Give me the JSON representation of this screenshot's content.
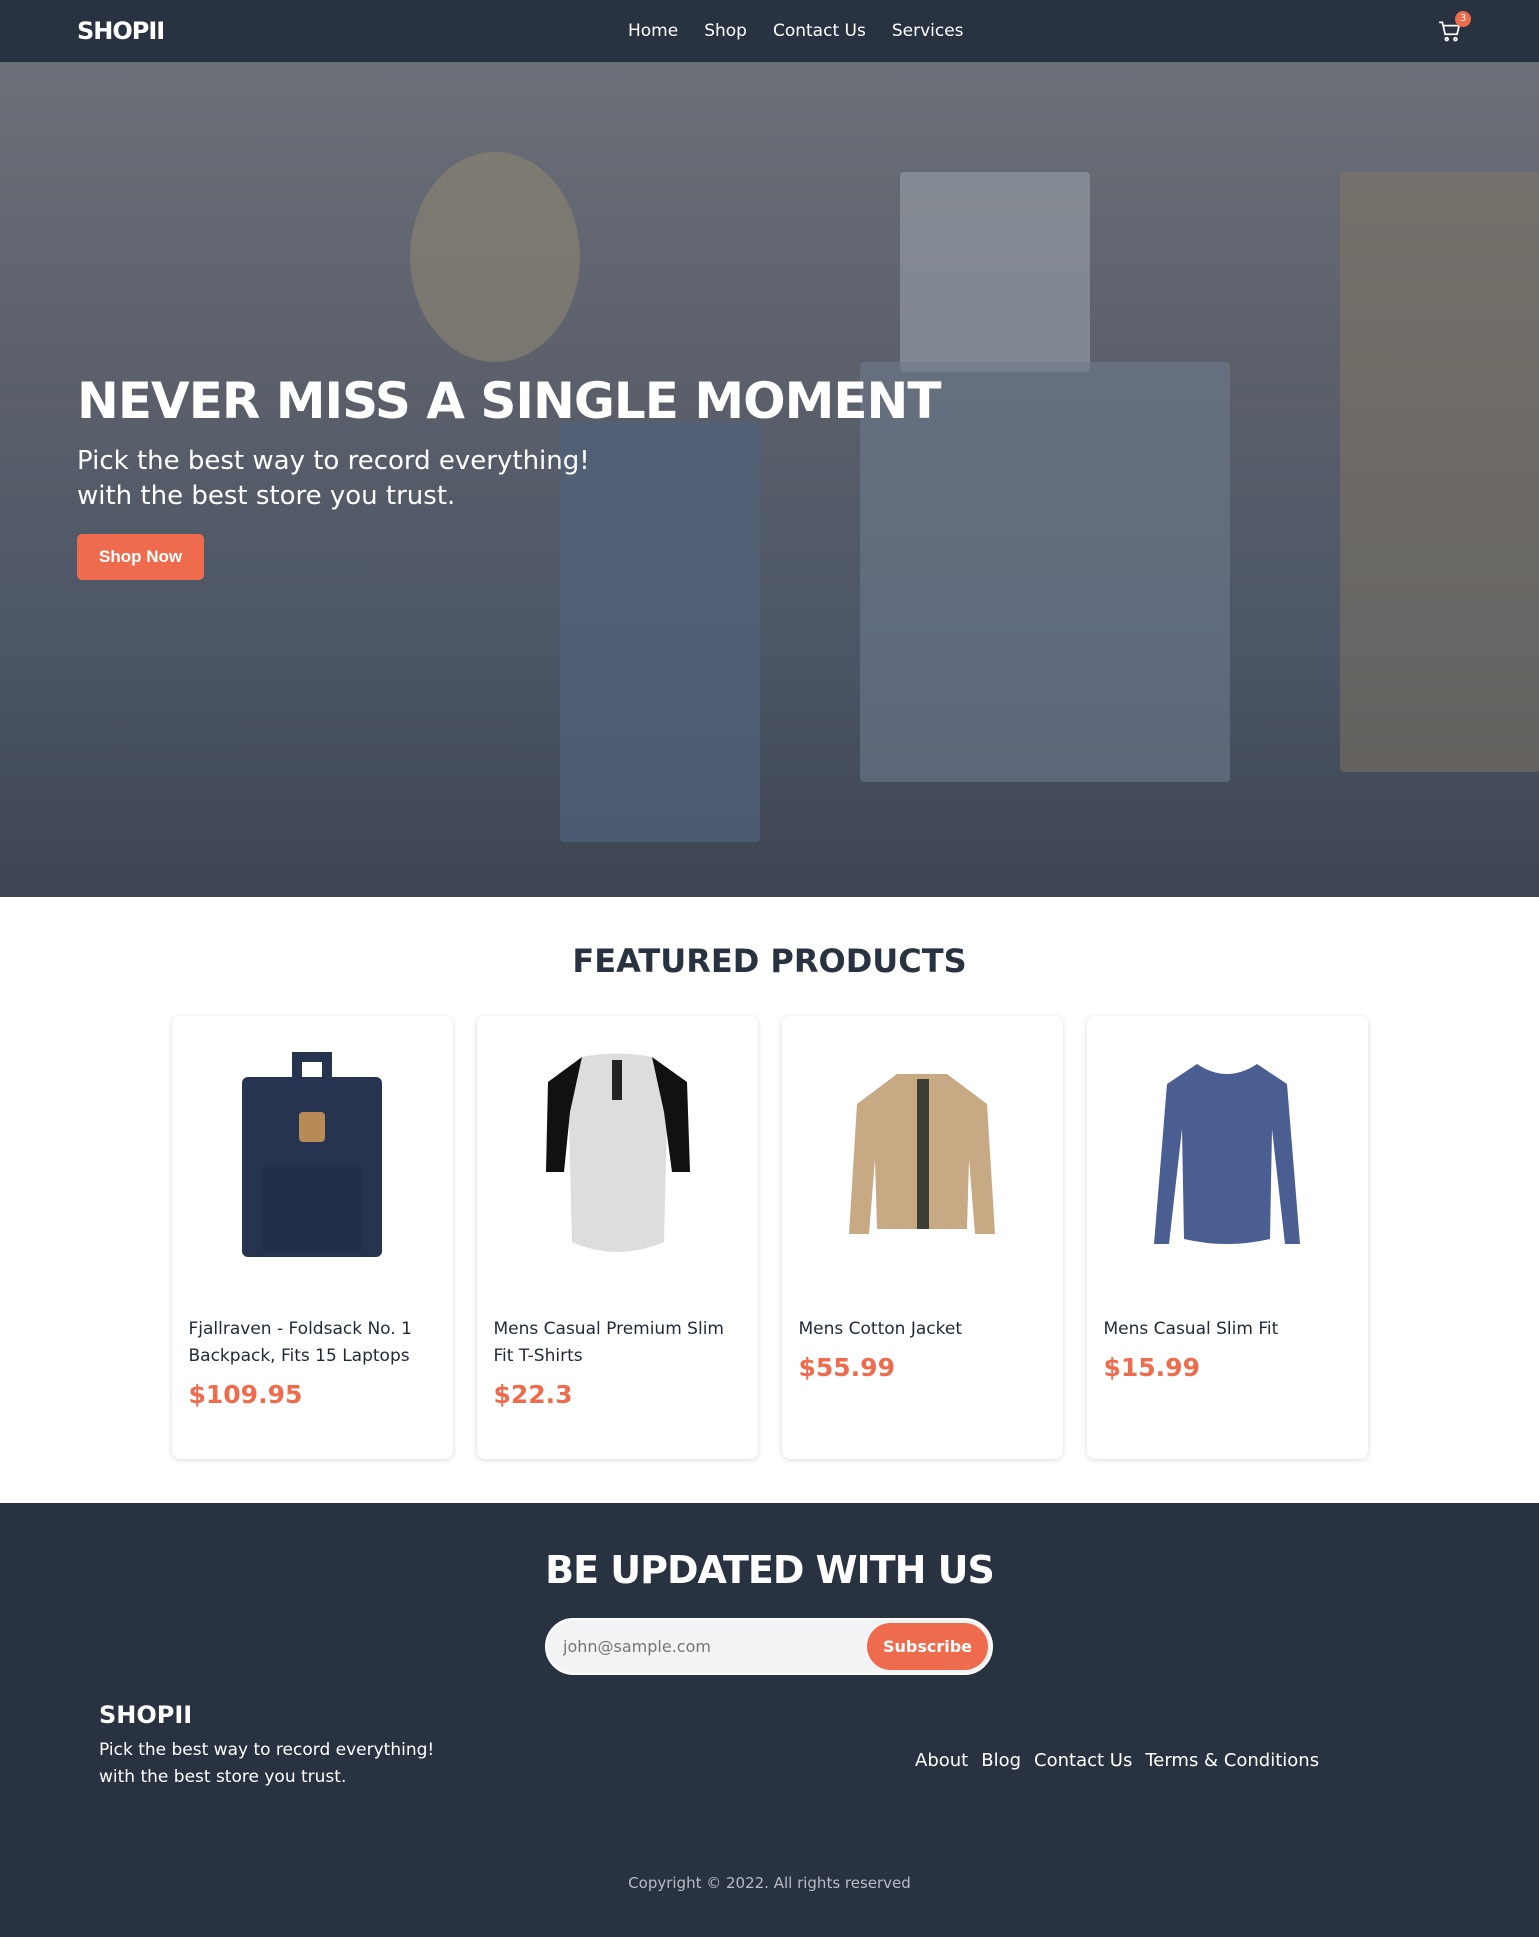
{
  "nav": {
    "logo": "SHOPII",
    "links": [
      "Home",
      "Shop",
      "Contact Us",
      "Services"
    ],
    "cart_count": "3",
    "cart_icon": "cart-icon"
  },
  "hero": {
    "title": "NEVER MISS A SINGLE MOMENT",
    "line1": "Pick the best way to record everything!",
    "line2": "with the best store you trust.",
    "button": "Shop Now"
  },
  "featured": {
    "title": "FEATURED PRODUCTS",
    "products": [
      {
        "title": "Fjallraven - Foldsack No. 1 Backpack, Fits 15 Laptops",
        "price": "$109.95"
      },
      {
        "title": "Mens Casual Premium Slim Fit T-Shirts",
        "price": "$22.3"
      },
      {
        "title": "Mens Cotton Jacket",
        "price": "$55.99"
      },
      {
        "title": "Mens Casual Slim Fit",
        "price": "$15.99"
      }
    ]
  },
  "footer": {
    "title": "BE UPDATED WITH US",
    "email_placeholder": "john@sample.com",
    "subscribe": "Subscribe",
    "logo": "SHOPII",
    "line1": "Pick the best way to record everything!",
    "line2": "with the best store you trust.",
    "links": [
      "About",
      "Blog",
      "Contact Us",
      "Terms & Conditions"
    ],
    "copyright": "Copyright © 2022. All rights reserved"
  },
  "colors": {
    "dark": "#293241",
    "accent": "#ee6c4d"
  }
}
